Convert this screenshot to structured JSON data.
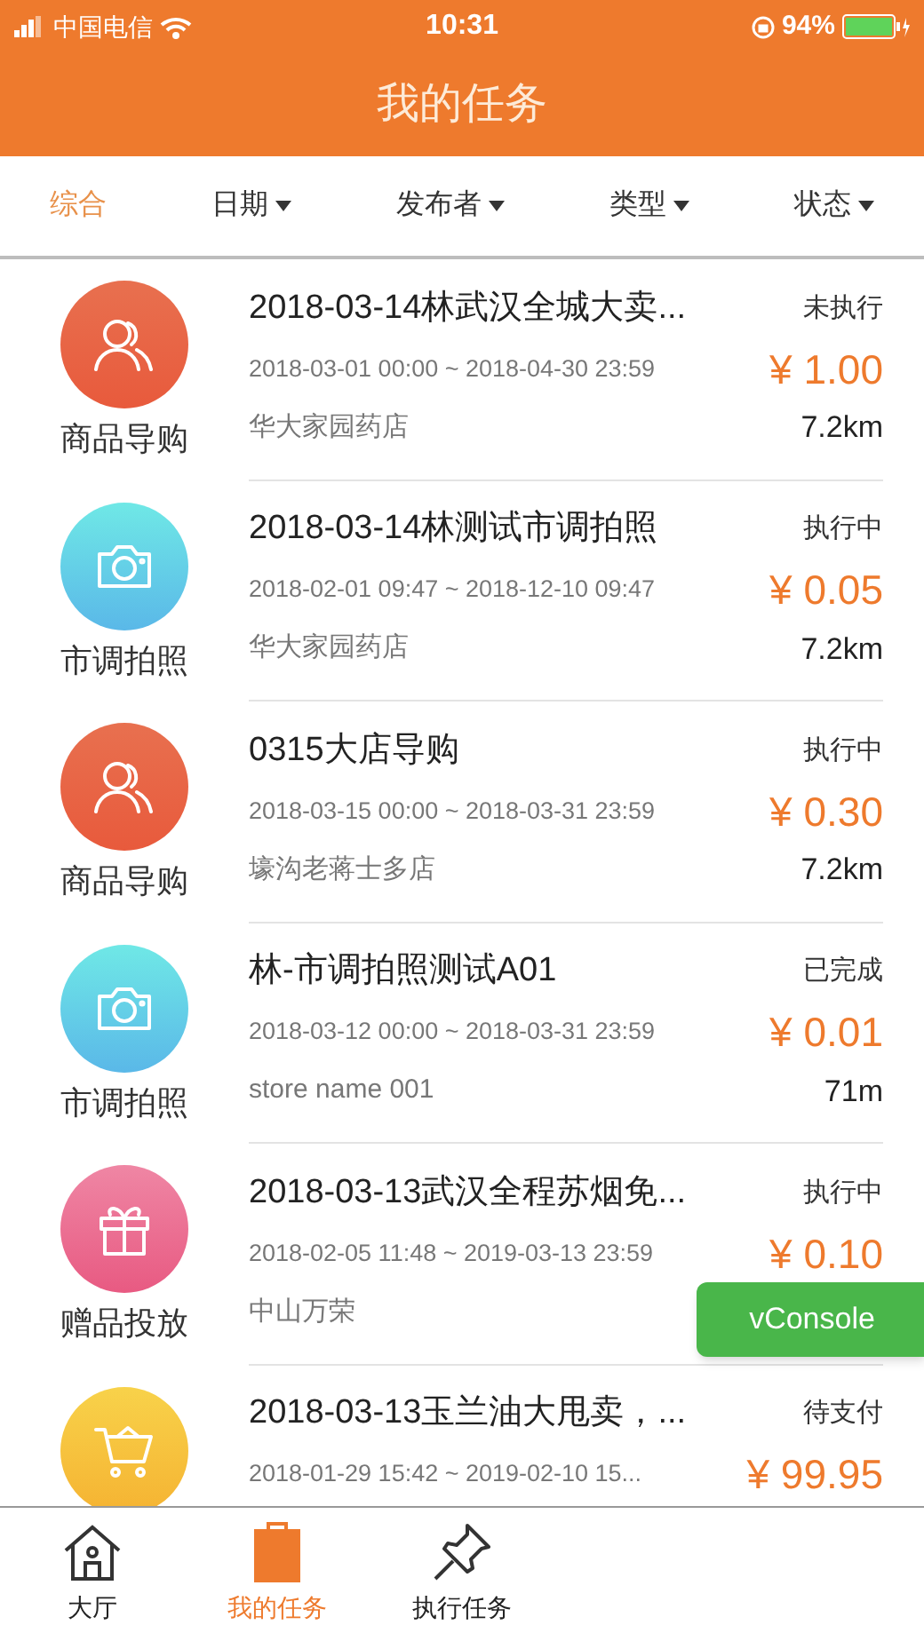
{
  "status_bar": {
    "carrier": "中国电信",
    "time": "10:31",
    "battery": "94%"
  },
  "header": {
    "title": "我的任务"
  },
  "filters": [
    {
      "label": "综合",
      "selected": true,
      "dropdown": false
    },
    {
      "label": "日期",
      "selected": false,
      "dropdown": true
    },
    {
      "label": "发布者",
      "selected": false,
      "dropdown": true
    },
    {
      "label": "类型",
      "selected": false,
      "dropdown": true
    },
    {
      "label": "状态",
      "selected": false,
      "dropdown": true
    }
  ],
  "tasks": [
    {
      "kind": "guide",
      "category": "商品导购",
      "title": "2018-03-14林武汉全城大卖...",
      "status": "未执行",
      "period": "2018-03-01 00:00 ~ 2018-04-30 23:59",
      "price": "¥ 1.00",
      "store": "华大家园药店",
      "distance": "7.2km"
    },
    {
      "kind": "photo",
      "category": "市调拍照",
      "title": "2018-03-14林测试市调拍照",
      "status": "执行中",
      "period": "2018-02-01 09:47 ~ 2018-12-10 09:47",
      "price": "¥ 0.05",
      "store": "华大家园药店",
      "distance": "7.2km"
    },
    {
      "kind": "guide",
      "category": "商品导购",
      "title": "0315大店导购",
      "status": "执行中",
      "period": "2018-03-15 00:00 ~ 2018-03-31 23:59",
      "price": "¥ 0.30",
      "store": "壕沟老蒋士多店",
      "distance": "7.2km"
    },
    {
      "kind": "photo",
      "category": "市调拍照",
      "title": "林-市调拍照测试A01",
      "status": "已完成",
      "period": "2018-03-12 00:00 ~ 2018-03-31 23:59",
      "price": "¥ 0.01",
      "store": "store name 001",
      "distance": "71m"
    },
    {
      "kind": "gift",
      "category": "赠品投放",
      "title": "2018-03-13武汉全程苏烟免...",
      "status": "执行中",
      "period": "2018-02-05 11:48 ~ 2019-03-13 23:59",
      "price": "¥ 0.10",
      "store": "中山万荣"
    },
    {
      "kind": "cart",
      "title": "2018-03-13玉兰油大甩卖，...",
      "status": "待支付",
      "period": "2018-01-29 15:42 ~ 2019-02-10 15...",
      "price": "¥ 99.95"
    }
  ],
  "floating_button": {
    "label": "vConsole"
  },
  "tab_bar": [
    {
      "kind": "home",
      "label": "大厅",
      "selected": false
    },
    {
      "kind": "clipboard",
      "label": "我的任务",
      "selected": true
    },
    {
      "kind": "pin",
      "label": "执行任务",
      "selected": false
    }
  ]
}
